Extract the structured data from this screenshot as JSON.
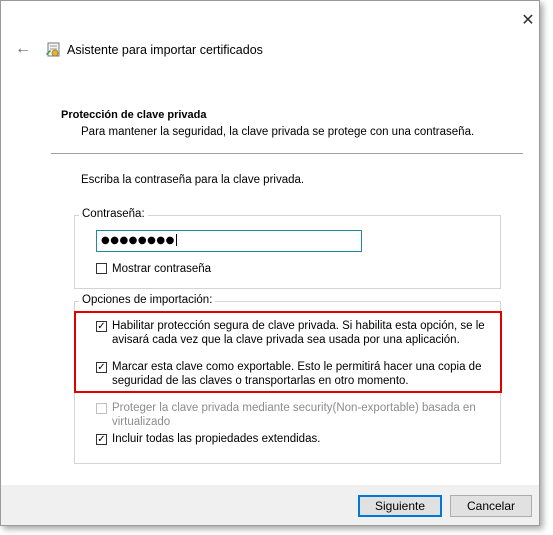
{
  "window": {
    "title": "Asistente para importar certificados",
    "close_glyph": "✕",
    "back_glyph": "←"
  },
  "section": {
    "heading": "Protección de clave privada",
    "subheading": "Para mantener la seguridad, la clave privada se protege con una contraseña."
  },
  "prompt": "Escriba la contraseña para la clave privada.",
  "password": {
    "label": "Contraseña:",
    "value": "●●●●●●●●",
    "show_label": "Mostrar contraseña",
    "show_checked": false
  },
  "import_options": {
    "title": "Opciones de importación:",
    "options": [
      {
        "line1": "Habilitar protección segura de clave privada. Si habilita esta opción, se le",
        "line2": "avisará cada vez que la clave privada sea usada por una aplicación.",
        "checked": true,
        "enabled": true
      },
      {
        "line1": "Marcar esta clave como exportable. Esto le permitirá hacer una copia de",
        "line2": "seguridad de las claves o transportarlas en otro momento.",
        "checked": true,
        "enabled": true
      },
      {
        "line1": "Proteger la clave privada mediante security(Non-exportable) basada en",
        "line2": "virtualizado",
        "checked": false,
        "enabled": false
      },
      {
        "line1": "Incluir todas las propiedades extendidas.",
        "line2": "",
        "checked": true,
        "enabled": true
      }
    ]
  },
  "buttons": {
    "next": "Siguiente",
    "cancel": "Cancelar"
  },
  "colors": {
    "highlight": "#e00000",
    "focus_border": "#1f8a9a",
    "default_button_border": "#0078d7",
    "footer_bg": "#f0f0f0"
  },
  "icons": [
    "close-icon",
    "back-arrow-icon",
    "certificate-wizard-icon",
    "checkmark-icon"
  ]
}
